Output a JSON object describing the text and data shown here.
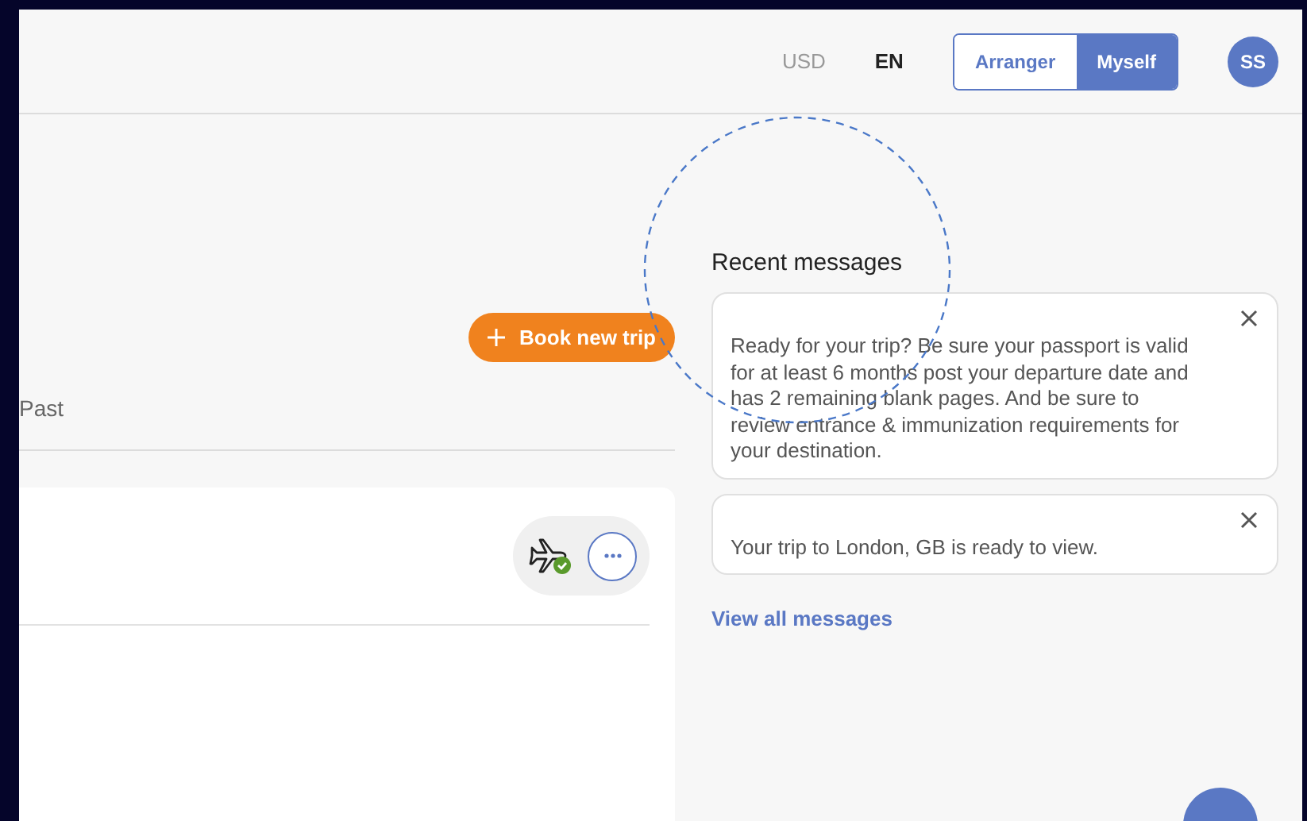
{
  "header": {
    "currency": "USD",
    "language": "EN",
    "role_toggle": [
      {
        "label": "Arranger",
        "selected": false
      },
      {
        "label": "Myself",
        "selected": true
      }
    ],
    "avatar": "SS"
  },
  "trips": {
    "book_button": "Book new trip",
    "tabs": [
      {
        "label": "Past",
        "selected": false
      }
    ],
    "trip_card": {
      "status_verified": true
    }
  },
  "messages": {
    "title": "Recent messages",
    "items": [
      {
        "text": "Ready for your trip? Be sure your passport is valid for at least 6 months post your departure date and has 2 remaining blank pages. And be sure to review entrance & immunization requirements for your destination."
      },
      {
        "text": "Your trip to London, GB is ready to view."
      }
    ],
    "view_all": "View all messages"
  }
}
